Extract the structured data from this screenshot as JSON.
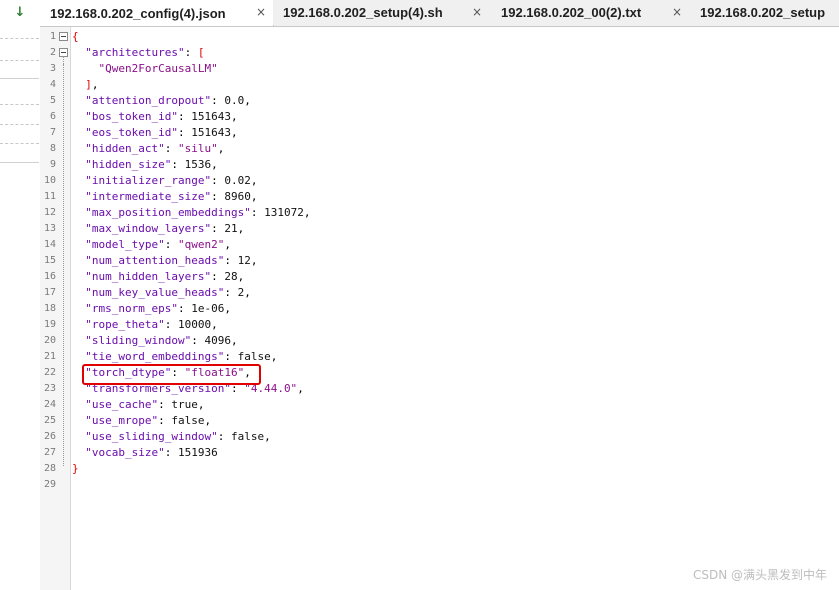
{
  "left_panel": {
    "arrow_icon": "down-arrow-icon"
  },
  "tabs": [
    {
      "label": "192.168.0.202_config(4).json",
      "close": "×",
      "active": true
    },
    {
      "label": "192.168.0.202_setup(4).sh",
      "close": "×",
      "active": false
    },
    {
      "label": "192.168.0.202_00(2).txt",
      "close": "×",
      "active": false
    },
    {
      "label": "192.168.0.202_setup",
      "close": "",
      "active": false
    }
  ],
  "editor": {
    "line_numbers": [
      "1",
      "2",
      "3",
      "4",
      "5",
      "6",
      "7",
      "8",
      "9",
      "10",
      "11",
      "12",
      "13",
      "14",
      "15",
      "16",
      "17",
      "18",
      "19",
      "20",
      "21",
      "22",
      "23",
      "24",
      "25",
      "26",
      "27",
      "28",
      "29"
    ],
    "lines": [
      [
        {
          "t": "{",
          "c": "brace"
        }
      ],
      [
        {
          "t": "  "
        },
        {
          "t": "\"architectures\"",
          "c": "key"
        },
        {
          "t": ": "
        },
        {
          "t": "[",
          "c": "brace"
        }
      ],
      [
        {
          "t": "    "
        },
        {
          "t": "\"Qwen2ForCausalLM\"",
          "c": "str"
        }
      ],
      [
        {
          "t": "  "
        },
        {
          "t": "]",
          "c": "brace"
        },
        {
          "t": ","
        }
      ],
      [
        {
          "t": "  "
        },
        {
          "t": "\"attention_dropout\"",
          "c": "key"
        },
        {
          "t": ": "
        },
        {
          "t": "0.0",
          "c": "num"
        },
        {
          "t": ","
        }
      ],
      [
        {
          "t": "  "
        },
        {
          "t": "\"bos_token_id\"",
          "c": "key"
        },
        {
          "t": ": "
        },
        {
          "t": "151643",
          "c": "num"
        },
        {
          "t": ","
        }
      ],
      [
        {
          "t": "  "
        },
        {
          "t": "\"eos_token_id\"",
          "c": "key"
        },
        {
          "t": ": "
        },
        {
          "t": "151643",
          "c": "num"
        },
        {
          "t": ","
        }
      ],
      [
        {
          "t": "  "
        },
        {
          "t": "\"hidden_act\"",
          "c": "key"
        },
        {
          "t": ": "
        },
        {
          "t": "\"silu\"",
          "c": "str"
        },
        {
          "t": ","
        }
      ],
      [
        {
          "t": "  "
        },
        {
          "t": "\"hidden_size\"",
          "c": "key"
        },
        {
          "t": ": "
        },
        {
          "t": "1536",
          "c": "num"
        },
        {
          "t": ","
        }
      ],
      [
        {
          "t": "  "
        },
        {
          "t": "\"initializer_range\"",
          "c": "key"
        },
        {
          "t": ": "
        },
        {
          "t": "0.02",
          "c": "num"
        },
        {
          "t": ","
        }
      ],
      [
        {
          "t": "  "
        },
        {
          "t": "\"intermediate_size\"",
          "c": "key"
        },
        {
          "t": ": "
        },
        {
          "t": "8960",
          "c": "num"
        },
        {
          "t": ","
        }
      ],
      [
        {
          "t": "  "
        },
        {
          "t": "\"max_position_embeddings\"",
          "c": "key"
        },
        {
          "t": ": "
        },
        {
          "t": "131072",
          "c": "num"
        },
        {
          "t": ","
        }
      ],
      [
        {
          "t": "  "
        },
        {
          "t": "\"max_window_layers\"",
          "c": "key"
        },
        {
          "t": ": "
        },
        {
          "t": "21",
          "c": "num"
        },
        {
          "t": ","
        }
      ],
      [
        {
          "t": "  "
        },
        {
          "t": "\"model_type\"",
          "c": "key"
        },
        {
          "t": ": "
        },
        {
          "t": "\"qwen2\"",
          "c": "str"
        },
        {
          "t": ","
        }
      ],
      [
        {
          "t": "  "
        },
        {
          "t": "\"num_attention_heads\"",
          "c": "key"
        },
        {
          "t": ": "
        },
        {
          "t": "12",
          "c": "num"
        },
        {
          "t": ","
        }
      ],
      [
        {
          "t": "  "
        },
        {
          "t": "\"num_hidden_layers\"",
          "c": "key"
        },
        {
          "t": ": "
        },
        {
          "t": "28",
          "c": "num"
        },
        {
          "t": ","
        }
      ],
      [
        {
          "t": "  "
        },
        {
          "t": "\"num_key_value_heads\"",
          "c": "key"
        },
        {
          "t": ": "
        },
        {
          "t": "2",
          "c": "num"
        },
        {
          "t": ","
        }
      ],
      [
        {
          "t": "  "
        },
        {
          "t": "\"rms_norm_eps\"",
          "c": "key"
        },
        {
          "t": ": "
        },
        {
          "t": "1e-06",
          "c": "num"
        },
        {
          "t": ","
        }
      ],
      [
        {
          "t": "  "
        },
        {
          "t": "\"rope_theta\"",
          "c": "key"
        },
        {
          "t": ": "
        },
        {
          "t": "10000",
          "c": "num"
        },
        {
          "t": ","
        }
      ],
      [
        {
          "t": "  "
        },
        {
          "t": "\"sliding_window\"",
          "c": "key"
        },
        {
          "t": ": "
        },
        {
          "t": "4096",
          "c": "num"
        },
        {
          "t": ","
        }
      ],
      [
        {
          "t": "  "
        },
        {
          "t": "\"tie_word_embeddings\"",
          "c": "key"
        },
        {
          "t": ": "
        },
        {
          "t": "false",
          "c": "kw"
        },
        {
          "t": ","
        }
      ],
      [
        {
          "t": "  "
        },
        {
          "t": "\"torch_dtype\"",
          "c": "key"
        },
        {
          "t": ": "
        },
        {
          "t": "\"float16\"",
          "c": "str"
        },
        {
          "t": ","
        }
      ],
      [
        {
          "t": "  "
        },
        {
          "t": "\"transformers_version\"",
          "c": "key"
        },
        {
          "t": ": "
        },
        {
          "t": "\"4.44.0\"",
          "c": "str"
        },
        {
          "t": ","
        }
      ],
      [
        {
          "t": "  "
        },
        {
          "t": "\"use_cache\"",
          "c": "key"
        },
        {
          "t": ": "
        },
        {
          "t": "true",
          "c": "kw"
        },
        {
          "t": ","
        }
      ],
      [
        {
          "t": "  "
        },
        {
          "t": "\"use_mrope\"",
          "c": "key"
        },
        {
          "t": ": "
        },
        {
          "t": "false",
          "c": "kw"
        },
        {
          "t": ","
        }
      ],
      [
        {
          "t": "  "
        },
        {
          "t": "\"use_sliding_window\"",
          "c": "key"
        },
        {
          "t": ": "
        },
        {
          "t": "false",
          "c": "kw"
        },
        {
          "t": ","
        }
      ],
      [
        {
          "t": "  "
        },
        {
          "t": "\"vocab_size\"",
          "c": "key"
        },
        {
          "t": ": "
        },
        {
          "t": "151936",
          "c": "num"
        }
      ],
      [
        {
          "t": "}",
          "c": "brace"
        }
      ],
      [
        {
          "t": ""
        }
      ]
    ],
    "highlighted_line": "22"
  },
  "watermark": "CSDN @满头黑发到中年"
}
